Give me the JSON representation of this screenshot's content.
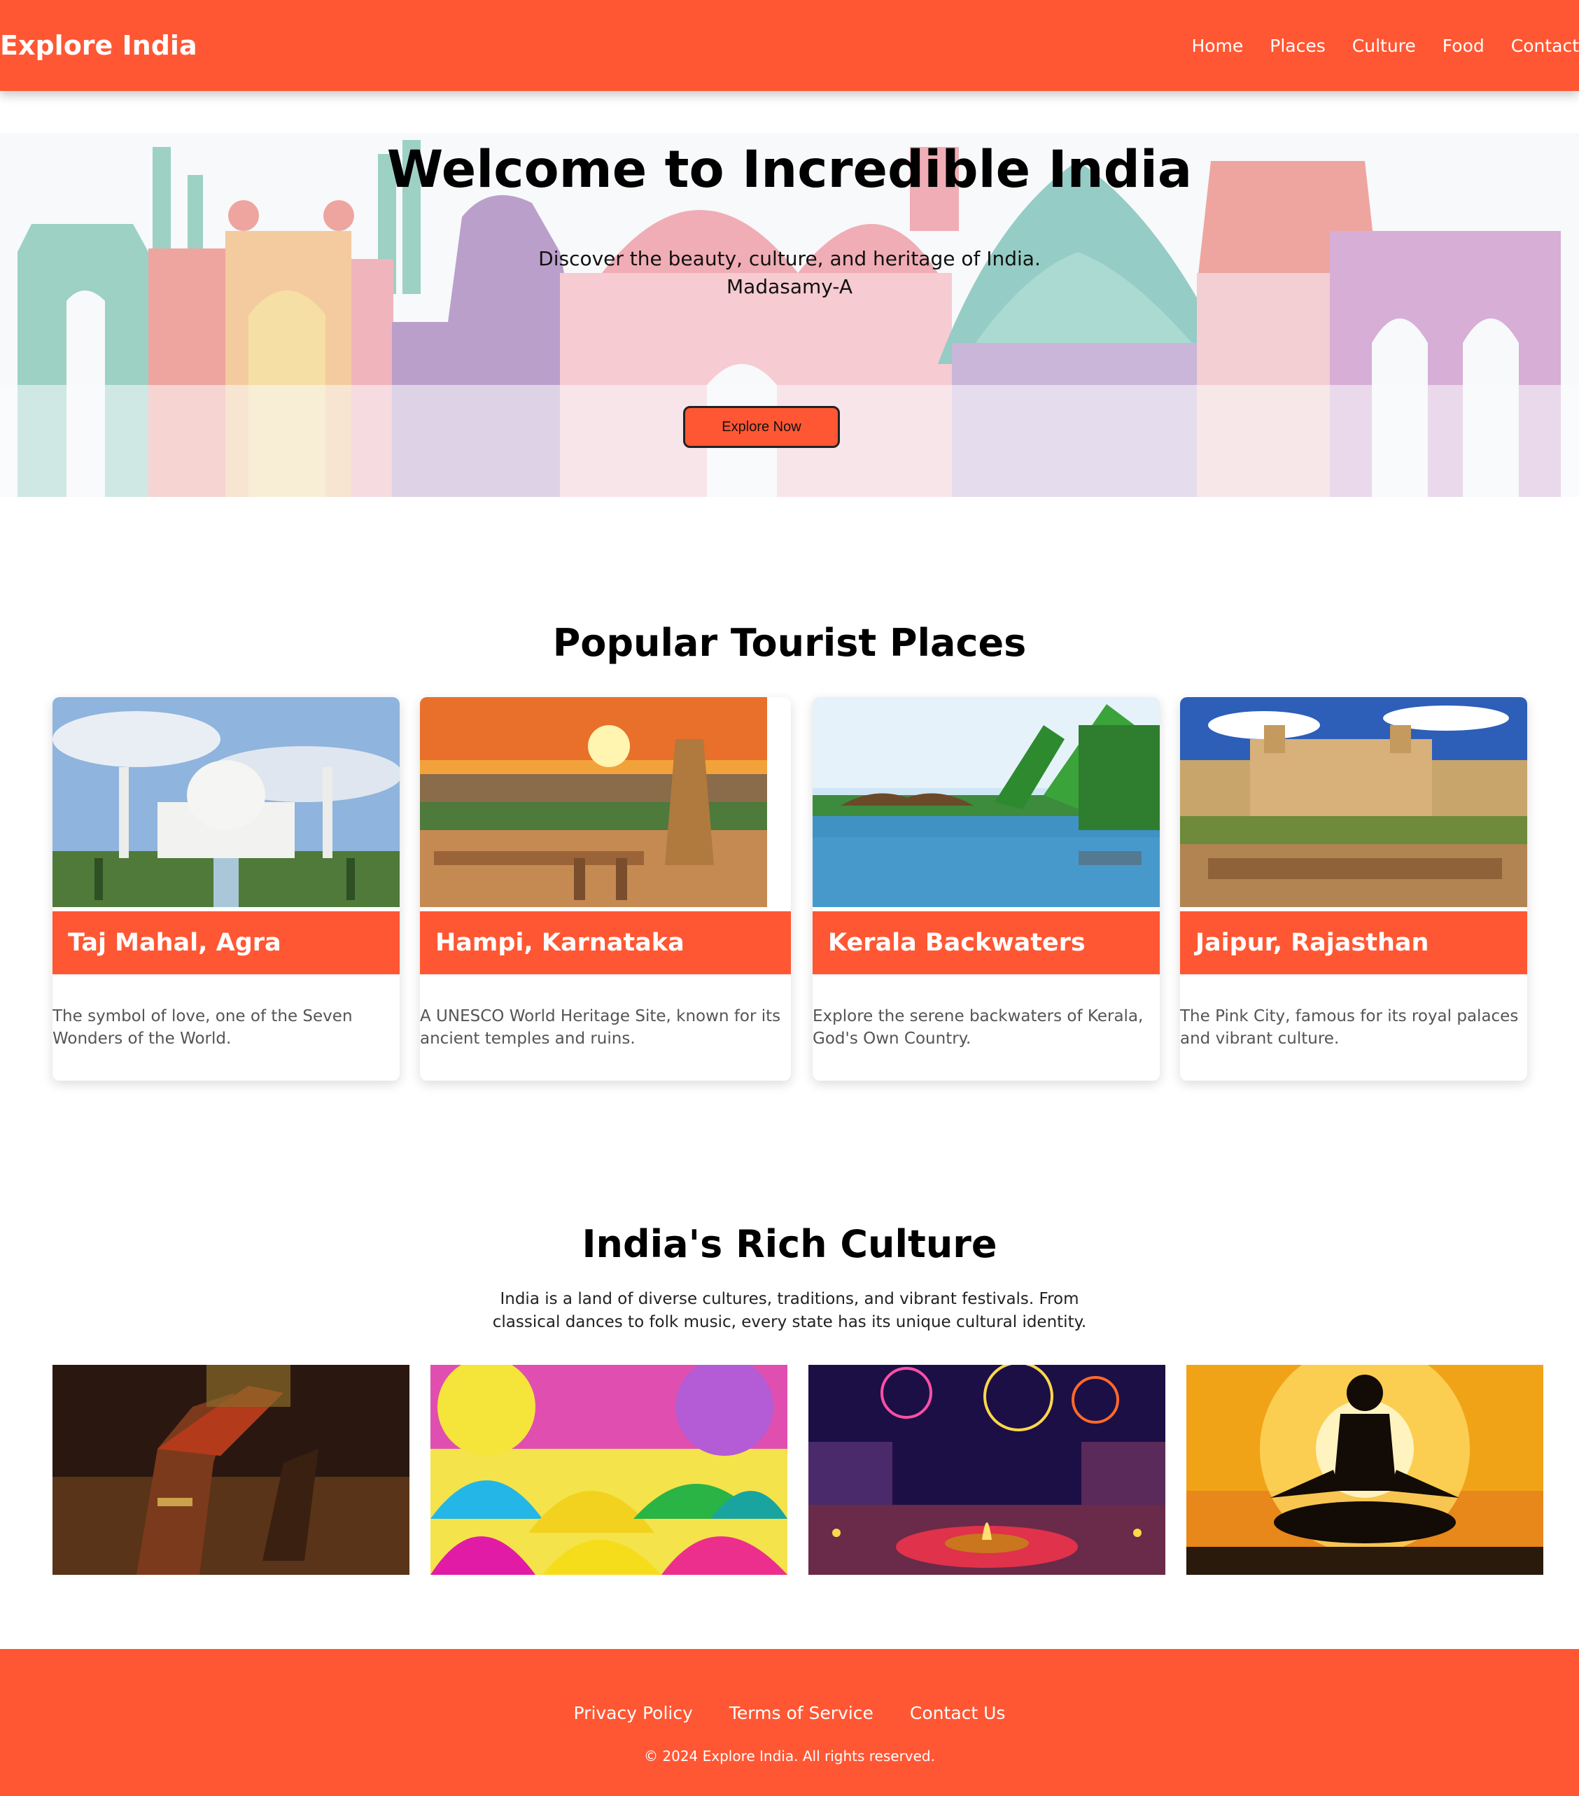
{
  "header": {
    "brand": "Explore India",
    "nav": [
      "Home",
      "Places",
      "Culture",
      "Food",
      "Contact"
    ]
  },
  "hero": {
    "title": "Welcome to Incredible India",
    "subtitle": "Discover the beauty, culture, and heritage of India.",
    "author": "Madasamy-A",
    "button": "Explore Now"
  },
  "places": {
    "title": "Popular Tourist Places",
    "cards": [
      {
        "name": "Taj Mahal, Agra",
        "description": "The symbol of love, one of the Seven Wonders of the World."
      },
      {
        "name": "Hampi, Karnataka",
        "description": "A UNESCO World Heritage Site, known for its ancient temples and ruins."
      },
      {
        "name": "Kerala Backwaters",
        "description": "Explore the serene backwaters of Kerala, God's Own Country."
      },
      {
        "name": "Jaipur, Rajasthan",
        "description": "The Pink City, famous for its royal palaces and vibrant culture."
      }
    ]
  },
  "culture": {
    "title": "India's Rich Culture",
    "description": "India is a land of diverse cultures, traditions, and vibrant festivals. From classical dances to folk music, every state has its unique cultural identity."
  },
  "footer": {
    "links": [
      "Privacy Policy",
      "Terms of Service",
      "Contact Us"
    ],
    "copyright": "© 2024 Explore India. All rights reserved."
  },
  "colors": {
    "primary": "#ff5733",
    "text": "#000000",
    "muted": "#555555"
  }
}
